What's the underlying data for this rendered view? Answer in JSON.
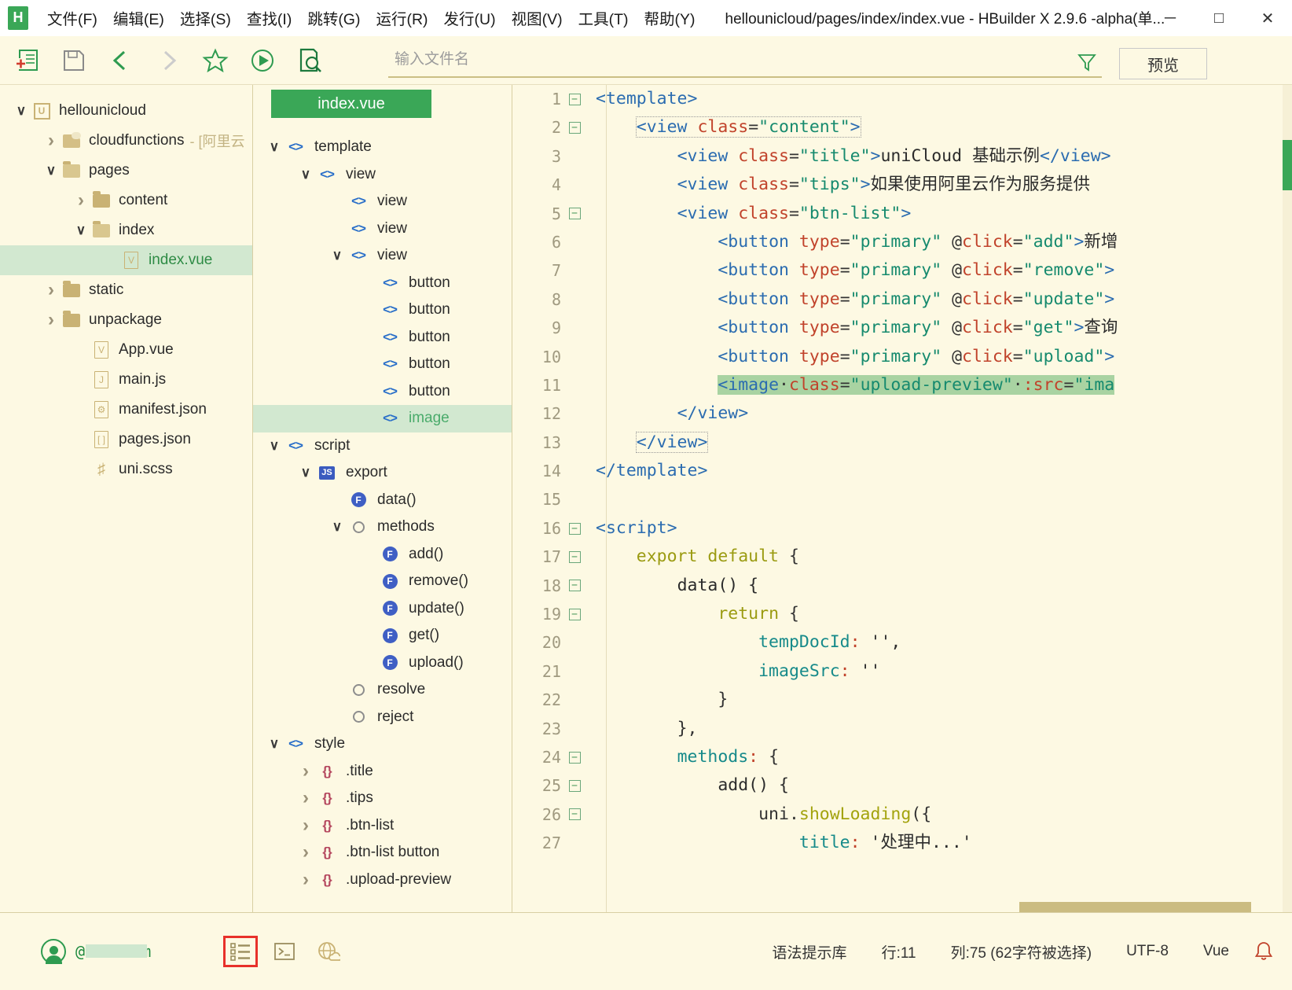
{
  "window": {
    "title": "hellounicloud/pages/index/index.vue - HBuilder X 2.9.6 -alpha(单...",
    "logo_text": "H",
    "minimize": "─",
    "maximize": "□",
    "close": "✕"
  },
  "menubar": {
    "items": [
      {
        "label": "文件(F)",
        "name": "menu-file"
      },
      {
        "label": "编辑(E)",
        "name": "menu-edit"
      },
      {
        "label": "选择(S)",
        "name": "menu-select"
      },
      {
        "label": "查找(I)",
        "name": "menu-find"
      },
      {
        "label": "跳转(G)",
        "name": "menu-goto"
      },
      {
        "label": "运行(R)",
        "name": "menu-run"
      },
      {
        "label": "发行(U)",
        "name": "menu-publish"
      },
      {
        "label": "视图(V)",
        "name": "menu-view"
      },
      {
        "label": "工具(T)",
        "name": "menu-tools"
      },
      {
        "label": "帮助(Y)",
        "name": "menu-help"
      }
    ]
  },
  "toolbar": {
    "icons": [
      "new-file-icon",
      "save-icon",
      "back-icon",
      "forward-icon",
      "favorite-icon",
      "run-icon",
      "file-search-icon"
    ],
    "search_placeholder": "输入文件名",
    "search_value": "",
    "filter_icon": "filter-icon",
    "preview_label": "预览"
  },
  "filetree": {
    "items": [
      {
        "label": "hellounicloud",
        "sub": "",
        "depth": 0,
        "chev": "open",
        "icon": "project-icon",
        "selected": false
      },
      {
        "label": "cloudfunctions",
        "sub": "- [阿里云",
        "depth": 1,
        "chev": "closed",
        "icon": "cloud-folder-icon",
        "selected": false
      },
      {
        "label": "pages",
        "sub": "",
        "depth": 1,
        "chev": "open",
        "icon": "folder-open-icon",
        "selected": false
      },
      {
        "label": "content",
        "sub": "",
        "depth": 2,
        "chev": "closed",
        "icon": "folder-icon",
        "selected": false
      },
      {
        "label": "index",
        "sub": "",
        "depth": 2,
        "chev": "open",
        "icon": "folder-open-icon",
        "selected": false
      },
      {
        "label": "index.vue",
        "sub": "",
        "depth": 3,
        "chev": "none",
        "icon": "vue-file-icon",
        "selected": true
      },
      {
        "label": "static",
        "sub": "",
        "depth": 1,
        "chev": "closed",
        "icon": "folder-icon",
        "selected": false
      },
      {
        "label": "unpackage",
        "sub": "",
        "depth": 1,
        "chev": "closed",
        "icon": "folder-icon",
        "selected": false
      },
      {
        "label": "App.vue",
        "sub": "",
        "depth": 2,
        "chev": "none",
        "icon": "vue-file-icon",
        "selected": false
      },
      {
        "label": "main.js",
        "sub": "",
        "depth": 2,
        "chev": "none",
        "icon": "js-file-icon",
        "selected": false
      },
      {
        "label": "manifest.json",
        "sub": "",
        "depth": 2,
        "chev": "none",
        "icon": "json-config-icon",
        "selected": false
      },
      {
        "label": "pages.json",
        "sub": "",
        "depth": 2,
        "chev": "none",
        "icon": "json-array-icon",
        "selected": false
      },
      {
        "label": "uni.scss",
        "sub": "",
        "depth": 2,
        "chev": "none",
        "icon": "scss-file-icon",
        "selected": false
      }
    ]
  },
  "outline": {
    "tab_label": "index.vue",
    "items": [
      {
        "label": "template",
        "depth": 0,
        "chev": "open",
        "icon": "tag-icon",
        "selected": false
      },
      {
        "label": "view",
        "depth": 1,
        "chev": "open",
        "icon": "tag-icon",
        "selected": false
      },
      {
        "label": "view",
        "depth": 2,
        "chev": "none",
        "icon": "tag-icon",
        "selected": false
      },
      {
        "label": "view",
        "depth": 2,
        "chev": "none",
        "icon": "tag-icon",
        "selected": false
      },
      {
        "label": "view",
        "depth": 2,
        "chev": "open",
        "icon": "tag-icon",
        "selected": false
      },
      {
        "label": "button",
        "depth": 3,
        "chev": "none",
        "icon": "tag-icon",
        "selected": false
      },
      {
        "label": "button",
        "depth": 3,
        "chev": "none",
        "icon": "tag-icon",
        "selected": false
      },
      {
        "label": "button",
        "depth": 3,
        "chev": "none",
        "icon": "tag-icon",
        "selected": false
      },
      {
        "label": "button",
        "depth": 3,
        "chev": "none",
        "icon": "tag-icon",
        "selected": false
      },
      {
        "label": "button",
        "depth": 3,
        "chev": "none",
        "icon": "tag-icon",
        "selected": false
      },
      {
        "label": "image",
        "depth": 3,
        "chev": "none",
        "icon": "tag-icon",
        "selected": true
      },
      {
        "label": "script",
        "depth": 0,
        "chev": "open",
        "icon": "tag-icon",
        "selected": false
      },
      {
        "label": "export",
        "depth": 1,
        "chev": "open",
        "icon": "js-icon",
        "selected": false
      },
      {
        "label": "data()",
        "depth": 2,
        "chev": "none",
        "icon": "function-icon",
        "selected": false
      },
      {
        "label": "methods",
        "depth": 2,
        "chev": "open",
        "icon": "object-icon",
        "selected": false
      },
      {
        "label": "add()",
        "depth": 3,
        "chev": "none",
        "icon": "function-icon",
        "selected": false
      },
      {
        "label": "remove()",
        "depth": 3,
        "chev": "none",
        "icon": "function-icon",
        "selected": false
      },
      {
        "label": "update()",
        "depth": 3,
        "chev": "none",
        "icon": "function-icon",
        "selected": false
      },
      {
        "label": "get()",
        "depth": 3,
        "chev": "none",
        "icon": "function-icon",
        "selected": false
      },
      {
        "label": "upload()",
        "depth": 3,
        "chev": "none",
        "icon": "function-icon",
        "selected": false
      },
      {
        "label": "resolve",
        "depth": 2,
        "chev": "none",
        "icon": "object-icon",
        "selected": false
      },
      {
        "label": "reject",
        "depth": 2,
        "chev": "none",
        "icon": "object-icon",
        "selected": false
      },
      {
        "label": "style",
        "depth": 0,
        "chev": "open",
        "icon": "tag-icon",
        "selected": false
      },
      {
        "label": ".title",
        "depth": 1,
        "chev": "closed",
        "icon": "css-rule-icon",
        "selected": false
      },
      {
        "label": ".tips",
        "depth": 1,
        "chev": "closed",
        "icon": "css-rule-icon",
        "selected": false
      },
      {
        "label": ".btn-list",
        "depth": 1,
        "chev": "closed",
        "icon": "css-rule-icon",
        "selected": false
      },
      {
        "label": ".btn-list button",
        "depth": 1,
        "chev": "closed",
        "icon": "css-rule-icon",
        "selected": false
      },
      {
        "label": ".upload-preview",
        "depth": 1,
        "chev": "closed",
        "icon": "css-rule-icon",
        "selected": false
      }
    ]
  },
  "editor": {
    "lines": [
      {
        "n": 1,
        "fold": "minus",
        "indent": 0,
        "tokens": [
          {
            "t": "tag",
            "v": "<template>"
          }
        ]
      },
      {
        "n": 2,
        "fold": "minus",
        "indent": 1,
        "box": true,
        "tokens": [
          {
            "t": "tag",
            "v": "<view "
          },
          {
            "t": "attr",
            "v": "class"
          },
          {
            "t": "plain",
            "v": "="
          },
          {
            "t": "str",
            "v": "\"content\""
          },
          {
            "t": "tag",
            "v": ">"
          }
        ]
      },
      {
        "n": 3,
        "fold": "",
        "indent": 2,
        "tokens": [
          {
            "t": "tag",
            "v": "<view "
          },
          {
            "t": "attr",
            "v": "class"
          },
          {
            "t": "plain",
            "v": "="
          },
          {
            "t": "str",
            "v": "\"title\""
          },
          {
            "t": "tag",
            "v": ">"
          },
          {
            "t": "txt",
            "v": "uniCloud 基础示例"
          },
          {
            "t": "tag",
            "v": "</view>"
          }
        ]
      },
      {
        "n": 4,
        "fold": "",
        "indent": 2,
        "tokens": [
          {
            "t": "tag",
            "v": "<view "
          },
          {
            "t": "attr",
            "v": "class"
          },
          {
            "t": "plain",
            "v": "="
          },
          {
            "t": "str",
            "v": "\"tips\""
          },
          {
            "t": "tag",
            "v": ">"
          },
          {
            "t": "txt",
            "v": "如果使用阿里云作为服务提供"
          }
        ]
      },
      {
        "n": 5,
        "fold": "minus",
        "indent": 2,
        "tokens": [
          {
            "t": "tag",
            "v": "<view "
          },
          {
            "t": "attr",
            "v": "class"
          },
          {
            "t": "plain",
            "v": "="
          },
          {
            "t": "str",
            "v": "\"btn-list\""
          },
          {
            "t": "tag",
            "v": ">"
          }
        ]
      },
      {
        "n": 6,
        "fold": "",
        "indent": 3,
        "tokens": [
          {
            "t": "tag",
            "v": "<button "
          },
          {
            "t": "attr",
            "v": "type"
          },
          {
            "t": "plain",
            "v": "="
          },
          {
            "t": "str",
            "v": "\"primary\""
          },
          {
            "t": "plain",
            "v": " @"
          },
          {
            "t": "attr",
            "v": "click"
          },
          {
            "t": "plain",
            "v": "="
          },
          {
            "t": "str",
            "v": "\"add\""
          },
          {
            "t": "tag",
            "v": ">"
          },
          {
            "t": "txt",
            "v": "新增"
          }
        ]
      },
      {
        "n": 7,
        "fold": "",
        "indent": 3,
        "tokens": [
          {
            "t": "tag",
            "v": "<button "
          },
          {
            "t": "attr",
            "v": "type"
          },
          {
            "t": "plain",
            "v": "="
          },
          {
            "t": "str",
            "v": "\"primary\""
          },
          {
            "t": "plain",
            "v": " @"
          },
          {
            "t": "attr",
            "v": "click"
          },
          {
            "t": "plain",
            "v": "="
          },
          {
            "t": "str",
            "v": "\"remove\""
          },
          {
            "t": "tag",
            "v": ">"
          }
        ]
      },
      {
        "n": 8,
        "fold": "",
        "indent": 3,
        "tokens": [
          {
            "t": "tag",
            "v": "<button "
          },
          {
            "t": "attr",
            "v": "type"
          },
          {
            "t": "plain",
            "v": "="
          },
          {
            "t": "str",
            "v": "\"primary\""
          },
          {
            "t": "plain",
            "v": " @"
          },
          {
            "t": "attr",
            "v": "click"
          },
          {
            "t": "plain",
            "v": "="
          },
          {
            "t": "str",
            "v": "\"update\""
          },
          {
            "t": "tag",
            "v": ">"
          }
        ]
      },
      {
        "n": 9,
        "fold": "",
        "indent": 3,
        "tokens": [
          {
            "t": "tag",
            "v": "<button "
          },
          {
            "t": "attr",
            "v": "type"
          },
          {
            "t": "plain",
            "v": "="
          },
          {
            "t": "str",
            "v": "\"primary\""
          },
          {
            "t": "plain",
            "v": " @"
          },
          {
            "t": "attr",
            "v": "click"
          },
          {
            "t": "plain",
            "v": "="
          },
          {
            "t": "str",
            "v": "\"get\""
          },
          {
            "t": "tag",
            "v": ">"
          },
          {
            "t": "txt",
            "v": "查询"
          }
        ]
      },
      {
        "n": 10,
        "fold": "",
        "indent": 3,
        "tokens": [
          {
            "t": "tag",
            "v": "<button "
          },
          {
            "t": "attr",
            "v": "type"
          },
          {
            "t": "plain",
            "v": "="
          },
          {
            "t": "str",
            "v": "\"primary\""
          },
          {
            "t": "plain",
            "v": " @"
          },
          {
            "t": "attr",
            "v": "click"
          },
          {
            "t": "plain",
            "v": "="
          },
          {
            "t": "str",
            "v": "\"upload\""
          },
          {
            "t": "tag",
            "v": ">"
          }
        ]
      },
      {
        "n": 11,
        "fold": "",
        "indent": 3,
        "sel": true,
        "tokens": [
          {
            "t": "tag",
            "v": "<image"
          },
          {
            "t": "plain",
            "v": "·"
          },
          {
            "t": "attr",
            "v": "class"
          },
          {
            "t": "plain",
            "v": "="
          },
          {
            "t": "str",
            "v": "\"upload-preview\""
          },
          {
            "t": "plain",
            "v": "·"
          },
          {
            "t": "attr",
            "v": ":src"
          },
          {
            "t": "plain",
            "v": "="
          },
          {
            "t": "str",
            "v": "\"ima"
          }
        ]
      },
      {
        "n": 12,
        "fold": "",
        "indent": 2,
        "tokens": [
          {
            "t": "tag",
            "v": "</view>"
          }
        ]
      },
      {
        "n": 13,
        "fold": "",
        "indent": 1,
        "box": true,
        "tokens": [
          {
            "t": "tag",
            "v": "</view>"
          }
        ]
      },
      {
        "n": 14,
        "fold": "",
        "indent": 0,
        "tokens": [
          {
            "t": "tag",
            "v": "</template>"
          }
        ]
      },
      {
        "n": 15,
        "fold": "",
        "indent": 0,
        "tokens": []
      },
      {
        "n": 16,
        "fold": "minus",
        "indent": 0,
        "tokens": [
          {
            "t": "tag",
            "v": "<script>"
          }
        ]
      },
      {
        "n": 17,
        "fold": "minus",
        "indent": 1,
        "tokens": [
          {
            "t": "kw",
            "v": "export default"
          },
          {
            "t": "plain",
            "v": " {"
          }
        ]
      },
      {
        "n": 18,
        "fold": "minus",
        "indent": 2,
        "tokens": [
          {
            "t": "fn",
            "v": "data() {"
          }
        ]
      },
      {
        "n": 19,
        "fold": "minus",
        "indent": 3,
        "tokens": [
          {
            "t": "kw",
            "v": "return"
          },
          {
            "t": "plain",
            "v": " {"
          }
        ]
      },
      {
        "n": 20,
        "fold": "",
        "indent": 4,
        "tokens": [
          {
            "t": "prop",
            "v": "tempDocId"
          },
          {
            "t": "punc",
            "v": ":"
          },
          {
            "t": "plain",
            "v": " "
          },
          {
            "t": "txt",
            "v": "'',"
          }
        ]
      },
      {
        "n": 21,
        "fold": "",
        "indent": 4,
        "tokens": [
          {
            "t": "prop",
            "v": "imageSrc"
          },
          {
            "t": "punc",
            "v": ":"
          },
          {
            "t": "plain",
            "v": " "
          },
          {
            "t": "txt",
            "v": "''"
          }
        ]
      },
      {
        "n": 22,
        "fold": "",
        "indent": 3,
        "tokens": [
          {
            "t": "plain",
            "v": "}"
          }
        ]
      },
      {
        "n": 23,
        "fold": "",
        "indent": 2,
        "tokens": [
          {
            "t": "plain",
            "v": "},"
          }
        ]
      },
      {
        "n": 24,
        "fold": "minus",
        "indent": 2,
        "tokens": [
          {
            "t": "prop",
            "v": "methods"
          },
          {
            "t": "punc",
            "v": ":"
          },
          {
            "t": "plain",
            "v": " {"
          }
        ]
      },
      {
        "n": 25,
        "fold": "minus",
        "indent": 3,
        "tokens": [
          {
            "t": "fn",
            "v": "add() {"
          }
        ]
      },
      {
        "n": 26,
        "fold": "minus",
        "indent": 4,
        "tokens": [
          {
            "t": "plain",
            "v": "uni."
          },
          {
            "t": "yellow",
            "v": "showLoading"
          },
          {
            "t": "plain",
            "v": "({"
          }
        ]
      },
      {
        "n": 27,
        "fold": "",
        "indent": 5,
        "tokens": [
          {
            "t": "prop",
            "v": "title"
          },
          {
            "t": "punc",
            "v": ":"
          },
          {
            "t": "plain",
            "v": " "
          },
          {
            "t": "txt",
            "v": "'处理中...'"
          }
        ]
      }
    ]
  },
  "statusbar": {
    "account": "@163.com",
    "icons": [
      {
        "name": "outline-view-icon",
        "boxed": true
      },
      {
        "name": "terminal-icon",
        "boxed": false
      },
      {
        "name": "browser-cloud-icon",
        "boxed": false
      }
    ],
    "syntax_lib": "语法提示库",
    "line": "行:11",
    "column": "列:75 (62字符被选择)",
    "encoding": "UTF-8",
    "language": "Vue",
    "bell": "notification-bell-icon"
  },
  "colors": {
    "accent_green": "#3aa757",
    "bg": "#fdf9e3",
    "selection": "#a9d3a2",
    "red_box": "#e8312a"
  }
}
